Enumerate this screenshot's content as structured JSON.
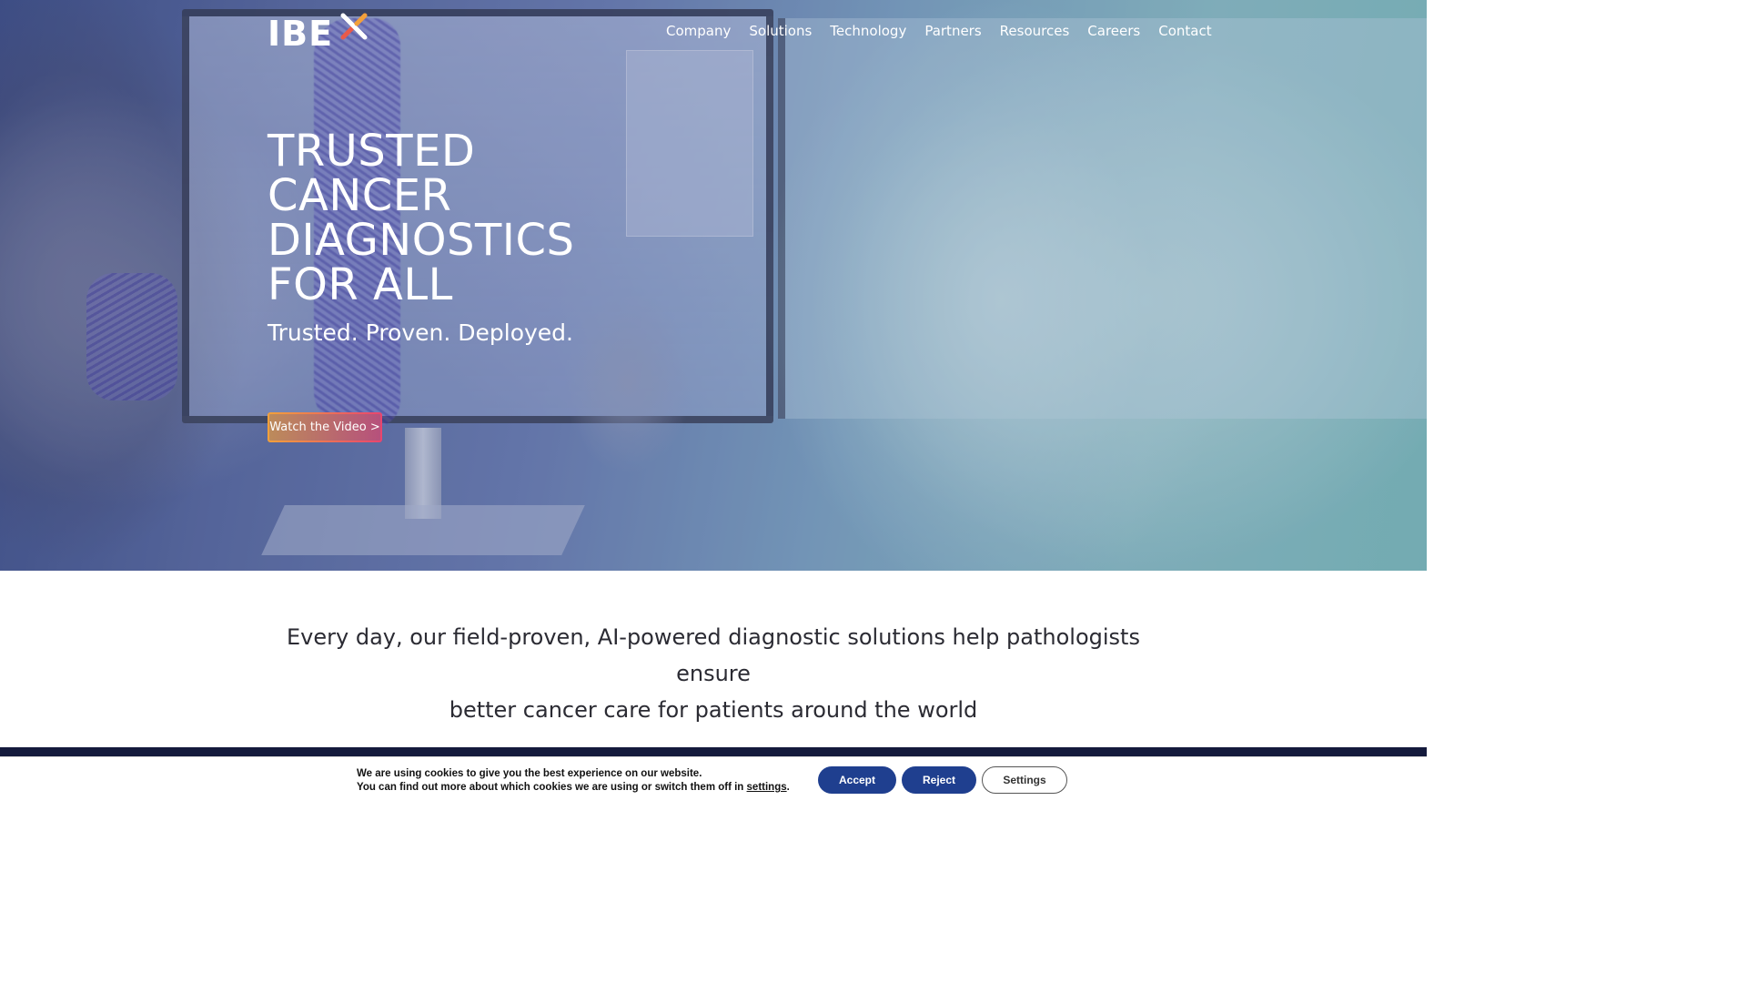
{
  "brand": {
    "logo_text": "IBE"
  },
  "nav": {
    "items": [
      {
        "label": "Company"
      },
      {
        "label": "Solutions"
      },
      {
        "label": "Technology"
      },
      {
        "label": "Partners"
      },
      {
        "label": "Resources"
      },
      {
        "label": "Careers"
      },
      {
        "label": "Contact"
      }
    ]
  },
  "hero": {
    "title_lines": [
      "TRUSTED",
      "CANCER",
      "DIAGNOSTICS",
      "FOR ALL"
    ],
    "subtitle": "Trusted. Proven. Deployed.",
    "cta_label": "Watch the Video >"
  },
  "tagline": {
    "line1": "Every day, our field-proven, AI-powered diagnostic solutions help pathologists ensure",
    "line2": "better cancer care for patients around the world"
  },
  "cookie": {
    "line1": "We are using cookies to give you the best experience on our website.",
    "line2_prefix": "You can find out more about which cookies we are using or switch them off in ",
    "line2_link": "settings",
    "line2_suffix": ".",
    "accept_label": "Accept",
    "reject_label": "Reject",
    "settings_label": "Settings"
  },
  "colors": {
    "accent_orange": "#f2a13a",
    "accent_pink": "#e8456f",
    "cookie_button_blue": "#1f3f8f",
    "dark_band": "#141a3c"
  }
}
